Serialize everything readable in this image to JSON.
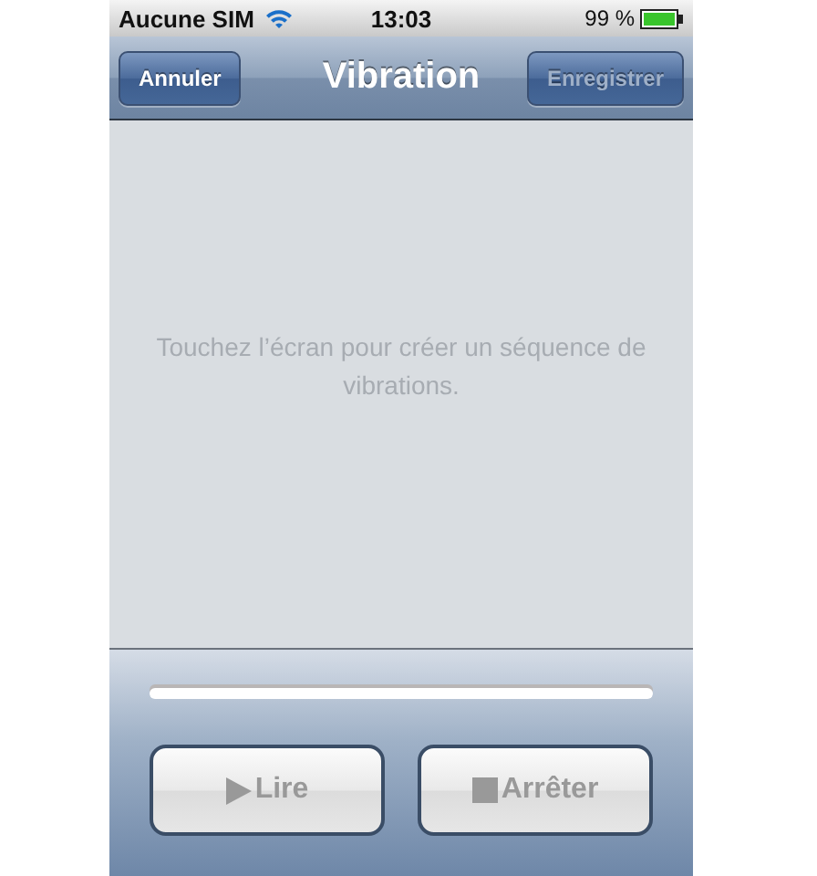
{
  "status_bar": {
    "carrier": "Aucune SIM",
    "time": "13:03",
    "battery": "99 %"
  },
  "nav_bar": {
    "title": "Vibration",
    "left_button": {
      "label": "Annuler",
      "disabled": false
    },
    "right_button": {
      "label": "Enregistrer",
      "disabled": true
    }
  },
  "content": {
    "hint": "Touchez l’écran pour créer un séquence de vibrations."
  },
  "progress": {
    "level": 0
  },
  "buttons": [
    {
      "kind": "play",
      "label": "Lire",
      "disabled": true
    },
    {
      "kind": "stop",
      "label": "Arrêter",
      "disabled": true
    }
  ]
}
